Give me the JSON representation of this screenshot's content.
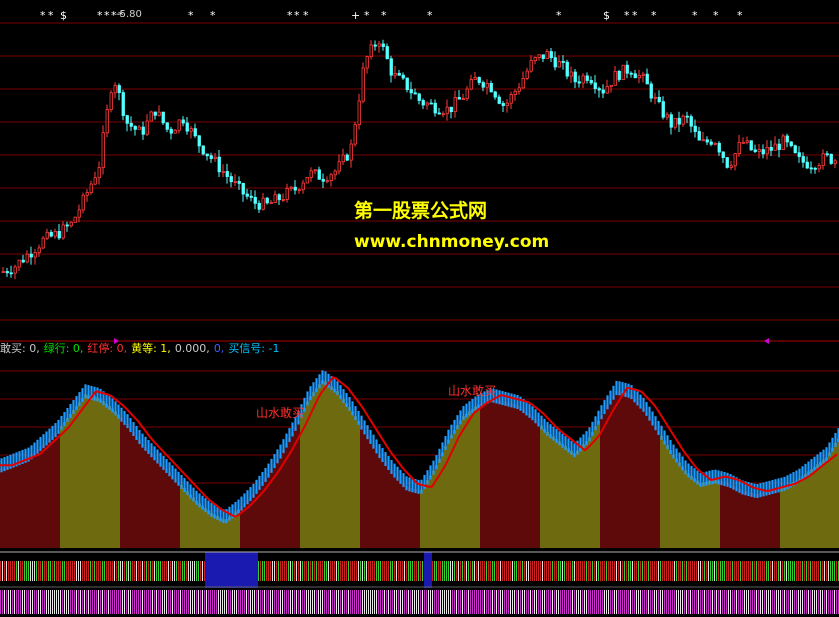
{
  "watermark": {
    "title": "第一股票公式网",
    "url": "www.chnmoney.com"
  },
  "price_label": "-5.80",
  "indicator_legend": [
    {
      "label": "敢买: 0,",
      "color": "#c8c8c8"
    },
    {
      "label": "绿行: 0,",
      "color": "#00e000"
    },
    {
      "label": "红停: 0,",
      "color": "#ff3030"
    },
    {
      "label": "黄等: 1,",
      "color": "#ffff00"
    },
    {
      "label": "0.000,",
      "color": "#c8c8c8"
    },
    {
      "label": "0,",
      "color": "#4060ff"
    },
    {
      "label": "买信号: -1",
      "color": "#00c0ff"
    }
  ],
  "annotations": [
    "山水敢买",
    "山水敢买"
  ],
  "colors": {
    "background": "#000000",
    "grid": "#7a0000",
    "up_candle": "#ff3c3c",
    "down_candle": "#54ffff",
    "blue_band": "#1e9bff",
    "red_line": "#e00000",
    "olive_fill": "#6e6a10",
    "maroon_fill": "#5e0a0a"
  },
  "chart_data": {
    "type": "candlestick",
    "title": "",
    "price_series": [
      108,
      112,
      120,
      128,
      132,
      138,
      155,
      175,
      232,
      202,
      195,
      210,
      196,
      205,
      190,
      180,
      170,
      160,
      152,
      150,
      155,
      160,
      170,
      168,
      172,
      185,
      240,
      255,
      232,
      225,
      215,
      212,
      210,
      218,
      230,
      225,
      212,
      225,
      240,
      245,
      238,
      228,
      232,
      222,
      232,
      236,
      228,
      212,
      200,
      205,
      188,
      192,
      175,
      190,
      182,
      185,
      190,
      178,
      176,
      180,
      178
    ],
    "oscillator_series": [
      42,
      45,
      48,
      55,
      62,
      72,
      82,
      80,
      74,
      66,
      56,
      48,
      40,
      32,
      24,
      18,
      14,
      20,
      28,
      38,
      50,
      64,
      80,
      90,
      84,
      74,
      62,
      50,
      40,
      32,
      30,
      42,
      58,
      70,
      76,
      80,
      78,
      76,
      70,
      62,
      56,
      50,
      58,
      72,
      84,
      82,
      74,
      62,
      50,
      40,
      34,
      36,
      34,
      30,
      28,
      30,
      32,
      36,
      42,
      48,
      60
    ],
    "signal_markers": "* * $ *** * * ** * * + * * ** $ * * * ** *"
  }
}
